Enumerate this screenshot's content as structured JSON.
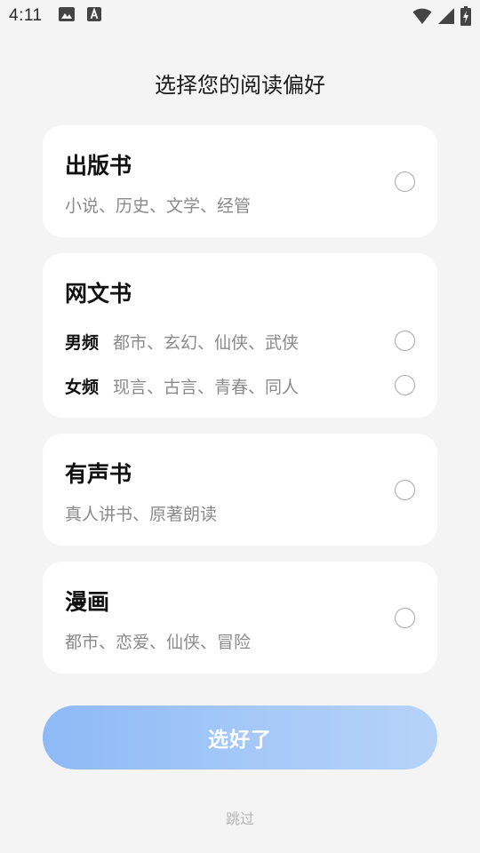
{
  "status_bar": {
    "time": "4:11",
    "icons_left": [
      "image-icon",
      "font-download-icon"
    ],
    "icons_right": [
      "wifi-icon",
      "signal-icon",
      "battery-charging-icon"
    ]
  },
  "page": {
    "title": "选择您的阅读偏好"
  },
  "cards": {
    "published": {
      "title": "出版书",
      "subtitle": "小说、历史、文学、经管",
      "selected": false
    },
    "web_novel": {
      "title": "网文书",
      "rows": [
        {
          "label": "男频",
          "text": "都市、玄幻、仙侠、武侠",
          "selected": false
        },
        {
          "label": "女频",
          "text": "现言、古言、青春、同人",
          "selected": false
        }
      ]
    },
    "audio": {
      "title": "有声书",
      "subtitle": "真人讲书、原著朗读",
      "selected": false
    },
    "comic": {
      "title": "漫画",
      "subtitle": "都市、恋爱、仙侠、冒险",
      "selected": false
    }
  },
  "actions": {
    "confirm_label": "选好了",
    "skip_label": "跳过"
  },
  "colors": {
    "background": "#f4f4f4",
    "card": "#ffffff",
    "button_gradient_start": "#8db9f6",
    "button_gradient_end": "#b6d2f9",
    "muted_text": "#8a8a8a"
  }
}
